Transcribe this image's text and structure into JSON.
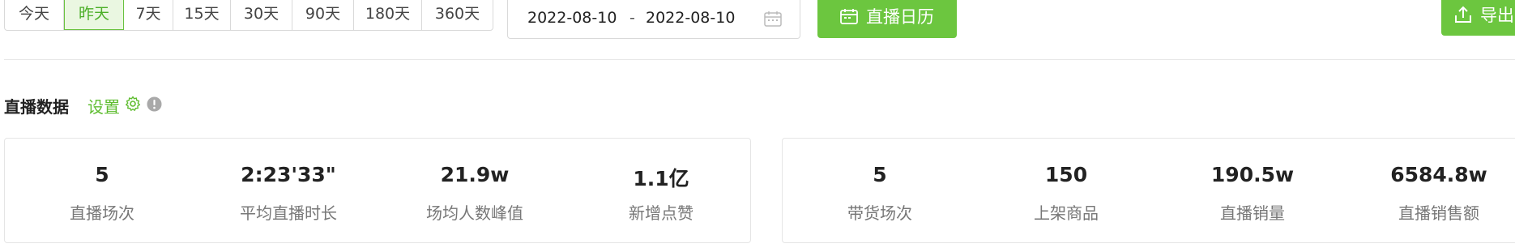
{
  "toolbar": {
    "ranges": [
      "今天",
      "昨天",
      "7天",
      "15天",
      "30天",
      "90天",
      "180天",
      "360天"
    ],
    "active_range": "昨天",
    "date_start": "2022-08-10",
    "date_separator": "-",
    "date_end": "2022-08-10",
    "calendar_button": "直播日历",
    "export_button": "导出"
  },
  "section": {
    "title": "直播数据",
    "settings_link": "设置"
  },
  "stats_left": [
    {
      "value": "5",
      "label": "直播场次"
    },
    {
      "value": "2:23'33\"",
      "label": "平均直播时长"
    },
    {
      "value": "21.9w",
      "label": "场均人数峰值"
    },
    {
      "value": "1.1亿",
      "label": "新增点赞"
    }
  ],
  "stats_right": [
    {
      "value": "5",
      "label": "带货场次"
    },
    {
      "value": "150",
      "label": "上架商品"
    },
    {
      "value": "190.5w",
      "label": "直播销量"
    },
    {
      "value": "6584.8w",
      "label": "直播销售额"
    }
  ],
  "colors": {
    "accent": "#6cc63f",
    "accent_text": "#5fbd30",
    "active_bg": "#eaf7e1"
  }
}
